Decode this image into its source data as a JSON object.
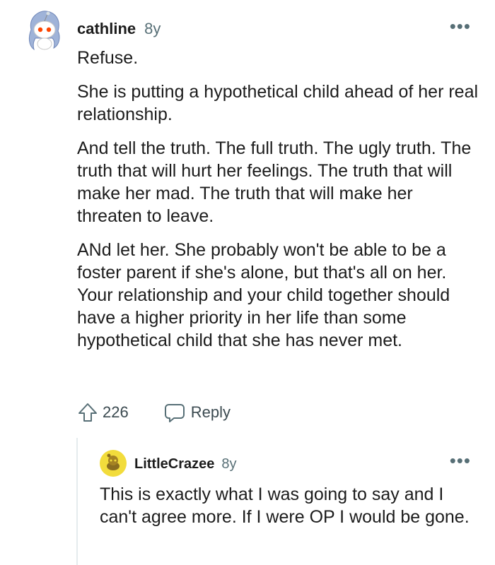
{
  "comment": {
    "username": "cathline",
    "age": "8y",
    "more_label": "•••",
    "paragraphs": [
      "Refuse.",
      "She is putting a hypothetical child ahead of her real relationship.",
      "And tell the truth. The full truth. The ugly truth. The truth that will hurt her feelings. The truth that will make her mad. The truth that will make her threaten to leave.",
      "ANd let her. She probably won't be able to be a foster parent if she's alone, but that's all on her. Your relationship and your child together should have a higher priority in her life than some hypothetical child that she has never met."
    ],
    "votes": "226",
    "reply_label": "Reply",
    "avatar_icon": "snoo-avatar-icon",
    "upvote_icon": "upvote-arrow-icon",
    "reply_icon": "speech-bubble-icon"
  },
  "reply": {
    "username": "LittleCrazee",
    "age": "8y",
    "more_label": "•••",
    "text": "This is exactly what I was going to say and I can't agree more. If I were OP I would be gone.",
    "avatar_icon": "snoo-avatar-icon",
    "avatar_color": "#f2dc3c"
  },
  "colors": {
    "meta_gray": "#576f76",
    "text": "#1c1c1c",
    "thread_line": "#e5ebee"
  }
}
